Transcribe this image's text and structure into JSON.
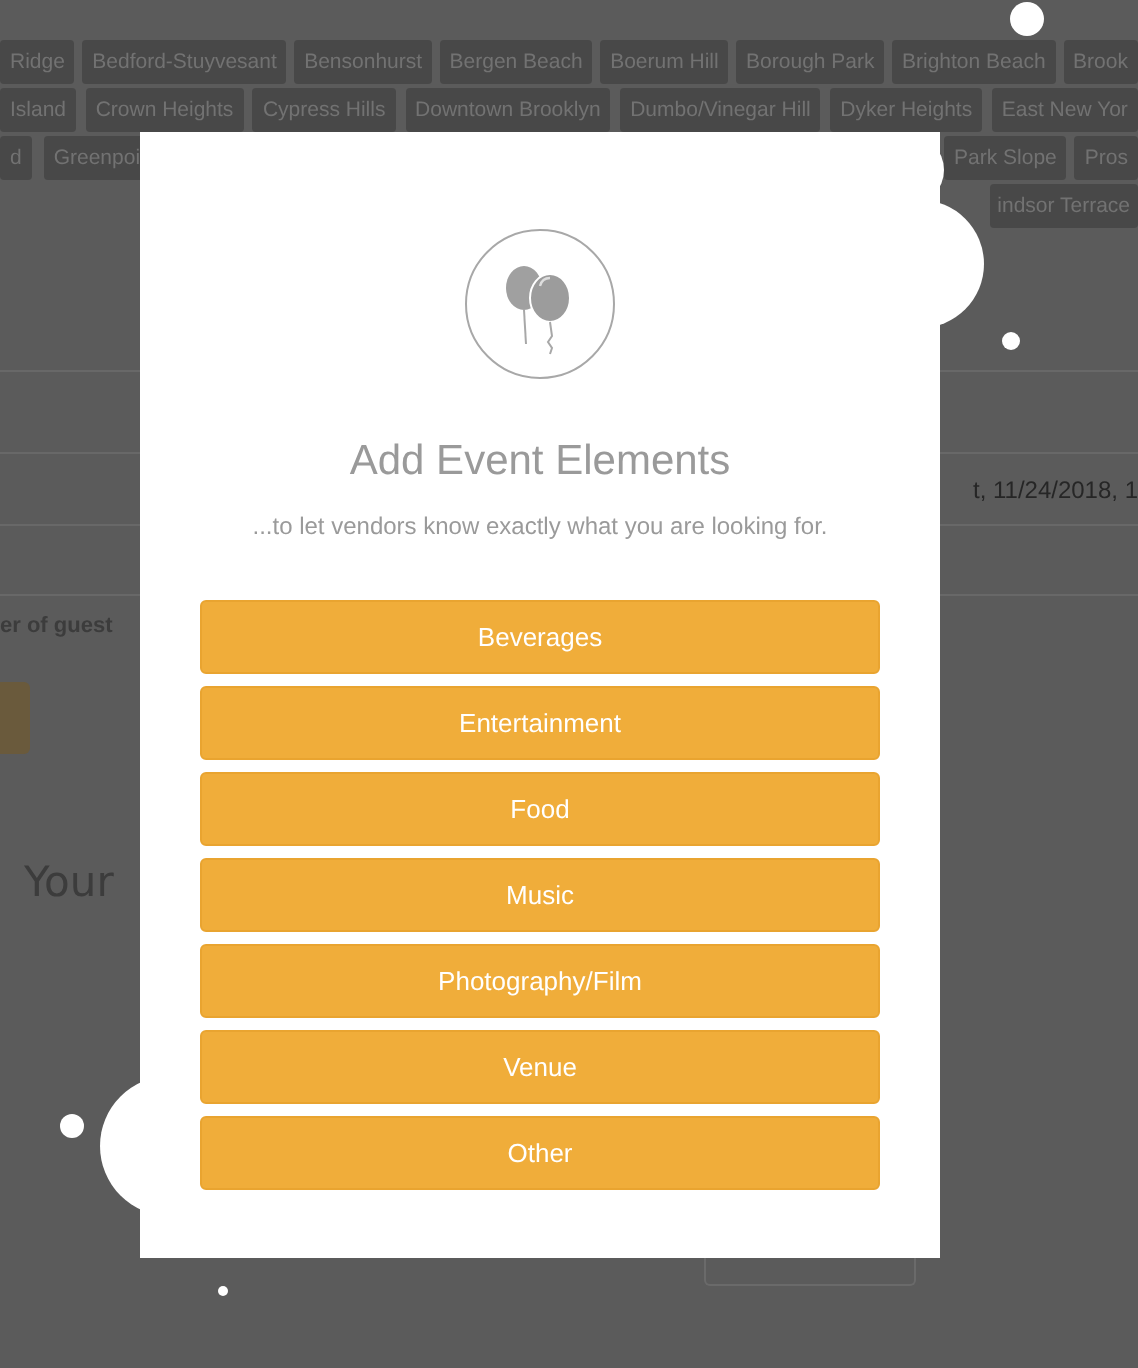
{
  "background_page": {
    "tag_rows": [
      {
        "left": [
          "Ridge",
          "Bedford-Stuyvesant",
          "Bensonhurst",
          "Bergen Beach",
          "Boerum Hill",
          "Borough Park",
          "Brighton Beach",
          "Brook"
        ],
        "right": []
      },
      {
        "left": [
          "Island",
          "Crown Heights",
          "Cypress Hills",
          "Downtown Brooklyn",
          "Dumbo/Vinegar Hill",
          "Dyker Heights",
          "East New Yor"
        ],
        "right": []
      },
      {
        "left": [
          "d",
          "Greenpoi"
        ],
        "right": [
          "Park Slope",
          "Pros"
        ]
      },
      {
        "left": [],
        "right": [
          "indsor Terrace"
        ]
      }
    ],
    "date_text": "t, 11/24/2018, 1",
    "guests_label": "er of guest",
    "section_heading": "Your"
  },
  "modal": {
    "title": "Add Event Elements",
    "subtitle": "...to let vendors know exactly what you are looking for.",
    "options": [
      "Beverages",
      "Entertainment",
      "Food",
      "Music",
      "Photography/Film",
      "Venue",
      "Other"
    ]
  }
}
